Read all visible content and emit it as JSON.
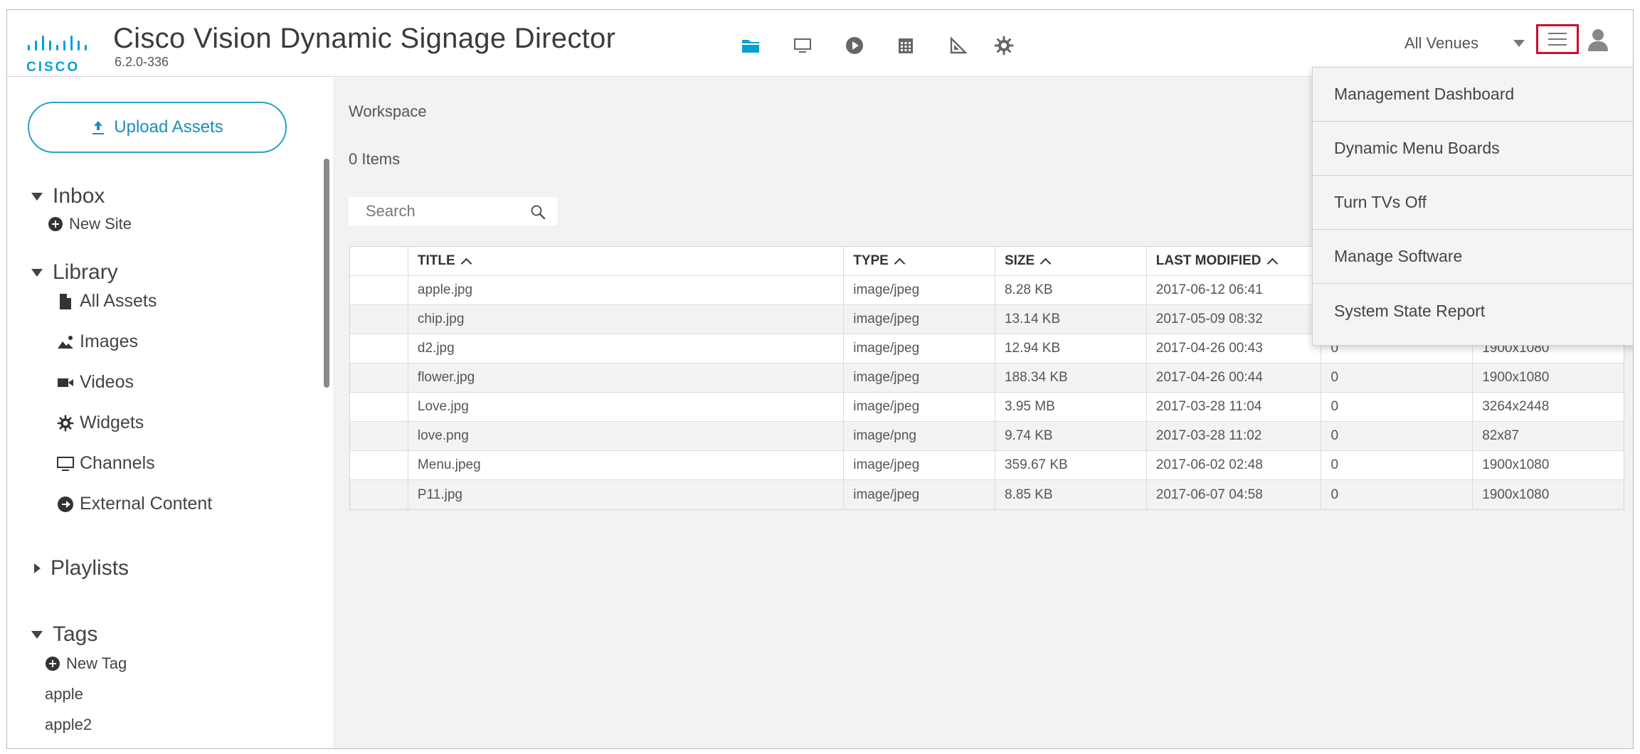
{
  "header": {
    "brand": "CISCO",
    "title": "Cisco Vision Dynamic Signage Director",
    "version": "6.2.0-336",
    "venue_selector": "All Venues",
    "nav_icons": [
      "folder-icon",
      "monitor-icon",
      "play-circle-icon",
      "calendar-grid-icon",
      "triangle-ruler-icon",
      "gear-icon"
    ],
    "accent_color": "#049fd9",
    "highlight_color": "#c8102e"
  },
  "sidebar": {
    "upload_label": "Upload Assets",
    "inbox": {
      "label": "Inbox",
      "new_site": "New Site"
    },
    "library": {
      "label": "Library",
      "items": [
        {
          "label": "All Assets",
          "icon": "file-icon"
        },
        {
          "label": "Images",
          "icon": "image-icon"
        },
        {
          "label": "Videos",
          "icon": "video-camera-icon"
        },
        {
          "label": "Widgets",
          "icon": "gear-icon"
        },
        {
          "label": "Channels",
          "icon": "monitor-icon"
        },
        {
          "label": "External Content",
          "icon": "external-arrow-icon"
        }
      ]
    },
    "playlists": {
      "label": "Playlists"
    },
    "tags": {
      "label": "Tags",
      "new_tag": "New Tag",
      "items": [
        "apple",
        "apple2"
      ]
    }
  },
  "main": {
    "workspace_label": "Workspace",
    "item_count": "0 Items",
    "search_placeholder": "Search",
    "table": {
      "headers": [
        "",
        "TITLE",
        "TYPE",
        "SIZE",
        "LAST MODIFIED",
        "",
        ""
      ],
      "rows": [
        [
          "",
          "apple.jpg",
          "image/jpeg",
          "8.28 KB",
          "2017-06-12 06:41",
          "",
          ""
        ],
        [
          "",
          "chip.jpg",
          "image/jpeg",
          "13.14 KB",
          "2017-05-09 08:32",
          "",
          ""
        ],
        [
          "",
          "d2.jpg",
          "image/jpeg",
          "12.94 KB",
          "2017-04-26 00:43",
          "0",
          "1900x1080"
        ],
        [
          "",
          "flower.jpg",
          "image/jpeg",
          "188.34 KB",
          "2017-04-26 00:44",
          "0",
          "1900x1080"
        ],
        [
          "",
          "Love.jpg",
          "image/jpeg",
          "3.95 MB",
          "2017-03-28 11:04",
          "0",
          "3264x2448"
        ],
        [
          "",
          "love.png",
          "image/png",
          "9.74 KB",
          "2017-03-28 11:02",
          "0",
          "82x87"
        ],
        [
          "",
          "Menu.jpeg",
          "image/jpeg",
          "359.67 KB",
          "2017-06-02 02:48",
          "0",
          "1900x1080"
        ],
        [
          "",
          "P11.jpg",
          "image/jpeg",
          "8.85 KB",
          "2017-06-07 04:58",
          "0",
          "1900x1080"
        ]
      ]
    }
  },
  "menu": {
    "items": [
      "Management Dashboard",
      "Dynamic Menu Boards",
      "Turn TVs Off",
      "Manage Software",
      "System State Report"
    ]
  }
}
